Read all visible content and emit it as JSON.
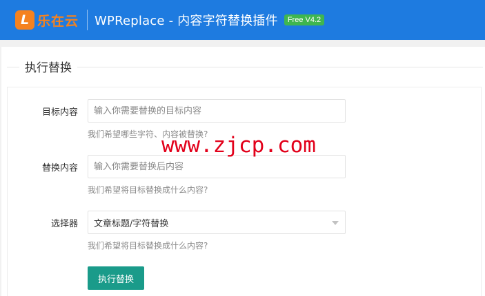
{
  "header": {
    "logo_text": "乐在云",
    "logo_letter": "L",
    "title": "WPReplace - 内容字符替换插件",
    "version": "Free V4.2"
  },
  "section": {
    "title": "执行替换"
  },
  "form": {
    "target": {
      "label": "目标内容",
      "placeholder": "输入你需要替换的目标内容",
      "hint": "我们希望哪些字符、内容被替换?"
    },
    "replacement": {
      "label": "替换内容",
      "placeholder": "输入你需要替换后内容",
      "hint": "我们希望将目标替换成什么内容?"
    },
    "selector": {
      "label": "选择器",
      "value": "文章标题/字符替换",
      "hint": "我们希望将目标替换成什么内容?"
    },
    "submit_label": "执行替换"
  },
  "watermark": "www.zjcp.com",
  "colors": {
    "header_bg": "#1e7be0",
    "logo": "#f5821f",
    "badge": "#3fb64f",
    "button": "#1a9b8a",
    "watermark": "#e2001a"
  }
}
